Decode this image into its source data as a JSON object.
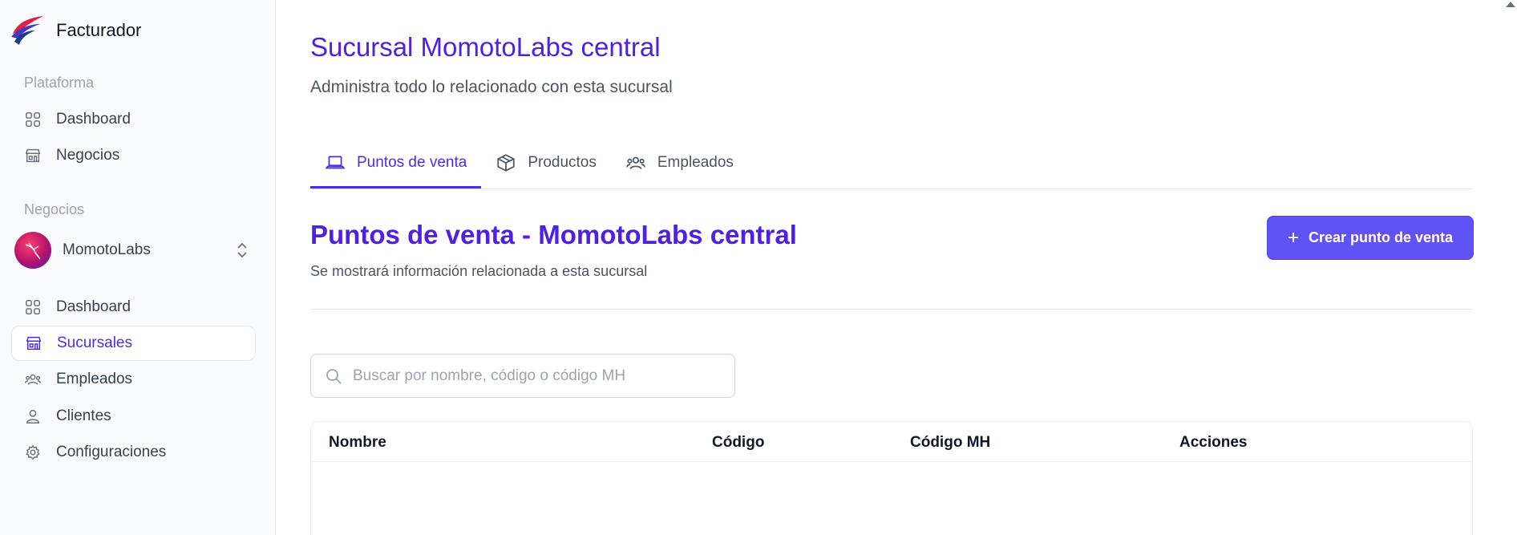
{
  "brand": {
    "name": "Facturador"
  },
  "sidebar": {
    "platform_title": "Plataforma",
    "platform_items": [
      {
        "label": "Dashboard",
        "icon": "grid-icon"
      },
      {
        "label": "Negocios",
        "icon": "store-icon"
      }
    ],
    "business_title": "Negocios",
    "business_switcher": {
      "name": "MomotoLabs"
    },
    "business_items": [
      {
        "label": "Dashboard",
        "icon": "grid-icon"
      },
      {
        "label": "Sucursales",
        "icon": "store-icon",
        "active": true
      },
      {
        "label": "Empleados",
        "icon": "users-icon"
      },
      {
        "label": "Clientes",
        "icon": "user-icon"
      },
      {
        "label": "Configuraciones",
        "icon": "gear-icon"
      }
    ]
  },
  "header": {
    "title": "Sucursal MomotoLabs central",
    "subtitle": "Administra todo lo relacionado con esta sucursal"
  },
  "tabs": [
    {
      "label": "Puntos de venta",
      "icon": "laptop-icon",
      "active": true
    },
    {
      "label": "Productos",
      "icon": "package-icon"
    },
    {
      "label": "Empleados",
      "icon": "users-icon"
    }
  ],
  "section": {
    "title": "Puntos de venta - MomotoLabs central",
    "subtitle": "Se mostrará información relacionada a esta sucursal",
    "create_button": "Crear punto de venta"
  },
  "search": {
    "placeholder": "Buscar por nombre, código o código MH",
    "value": ""
  },
  "table": {
    "columns": [
      "Nombre",
      "Código",
      "Código MH",
      "Acciones"
    ],
    "rows": []
  },
  "colors": {
    "accent": "#4f2be8",
    "button": "#6152f5"
  }
}
